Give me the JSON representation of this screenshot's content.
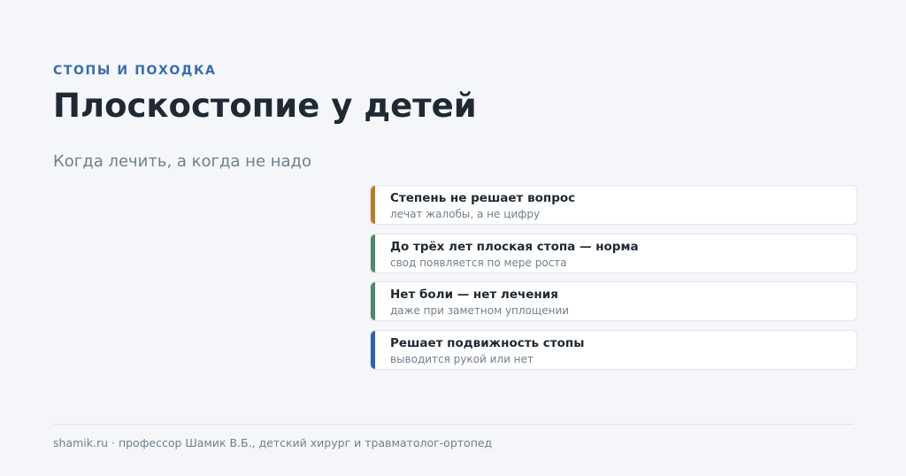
{
  "header": {
    "eyebrow": "СТОПЫ И ПОХОДКА",
    "title": "Плоскостопие у детей",
    "subtitle": "Когда лечить, а когда не надо"
  },
  "cards": [
    {
      "title": "Степень не решает вопрос",
      "subtitle": "лечат жалобы, а не цифру",
      "accent_color": "#b87d2e"
    },
    {
      "title": "До трёх лет плоская стопа — норма",
      "subtitle": "свод появляется по мере роста",
      "accent_color": "#4c8a68"
    },
    {
      "title": "Нет боли — нет лечения",
      "subtitle": "даже при заметном уплощении",
      "accent_color": "#4c8a68"
    },
    {
      "title": "Решает подвижность стопы",
      "subtitle": "выводится рукой или нет",
      "accent_color": "#2f63a6"
    }
  ],
  "footer": {
    "text": "shamik.ru · профессор Шамик В.Б., детский хирург и травматолог-ортопед"
  }
}
